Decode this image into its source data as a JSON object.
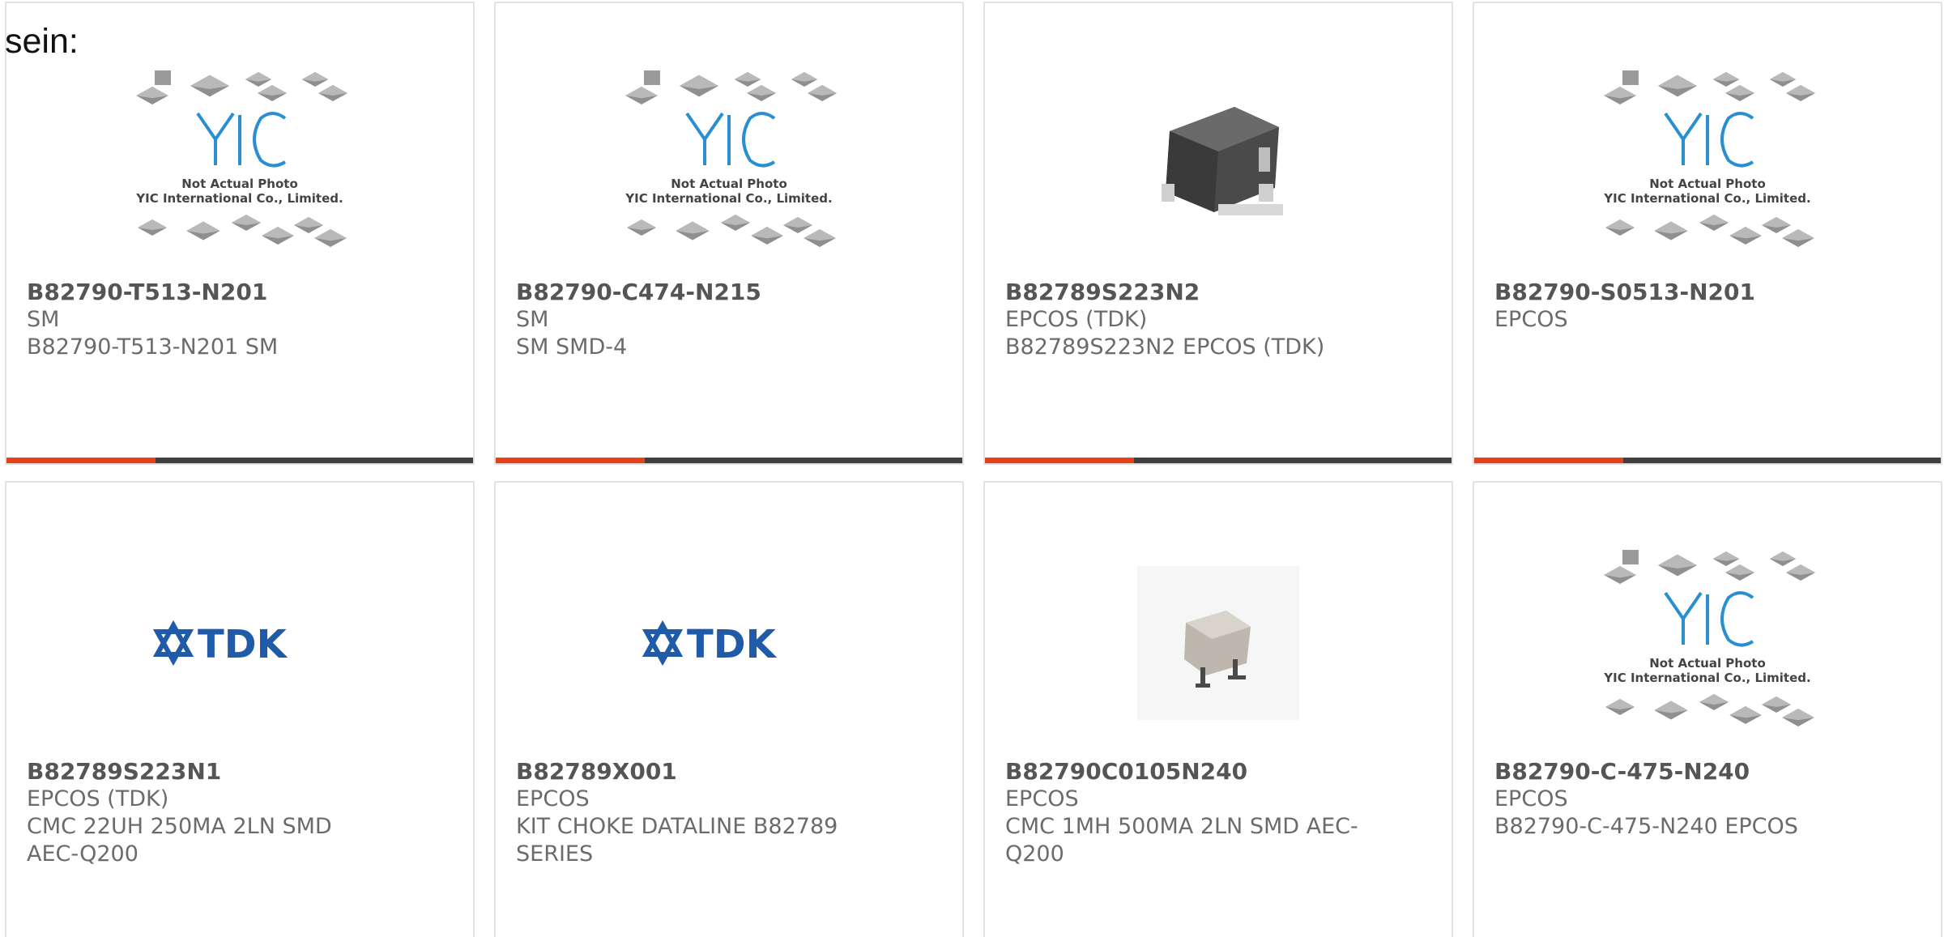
{
  "intro_text": "sein:",
  "placeholder_photo": {
    "logo_text": "YIC",
    "line1": "Not Actual Photo",
    "line2": "YIC International Co., Limited."
  },
  "brand_logo_text": "TDK",
  "products": [
    {
      "part": "B82790-T513-N201",
      "manufacturer": "SM",
      "description": "B82790-T513-N201 SM",
      "image": "yic-placeholder"
    },
    {
      "part": "B82790-C474-N215",
      "manufacturer": "SM",
      "description": "SM SMD-4",
      "image": "yic-placeholder"
    },
    {
      "part": "B82789S223N2",
      "manufacturer": "EPCOS (TDK)",
      "description": "B82789S223N2 EPCOS (TDK)",
      "image": "inductor-photo"
    },
    {
      "part": "B82790-S0513-N201",
      "manufacturer": "EPCOS",
      "description": "",
      "image": "yic-placeholder"
    },
    {
      "part": "B82789S223N1",
      "manufacturer": "EPCOS (TDK)",
      "description": "CMC 22UH 250MA 2LN SMD AEC-Q200",
      "image": "tdk-logo"
    },
    {
      "part": "B82789X001",
      "manufacturer": "EPCOS",
      "description": "KIT CHOKE DATALINE B82789 SERIES",
      "image": "tdk-logo"
    },
    {
      "part": "B82790C0105N240",
      "manufacturer": "EPCOS",
      "description": "CMC 1MH 500MA 2LN SMD AEC-Q200",
      "image": "choke-photo"
    },
    {
      "part": "B82790-C-475-N240",
      "manufacturer": "EPCOS",
      "description": "B82790-C-475-N240 EPCOS",
      "image": "yic-placeholder"
    }
  ],
  "colors": {
    "accent": "#e8411a",
    "bar": "#3f3f3f",
    "tdk_blue": "#1f5ba8",
    "yic_blue": "#2a8fd0"
  }
}
